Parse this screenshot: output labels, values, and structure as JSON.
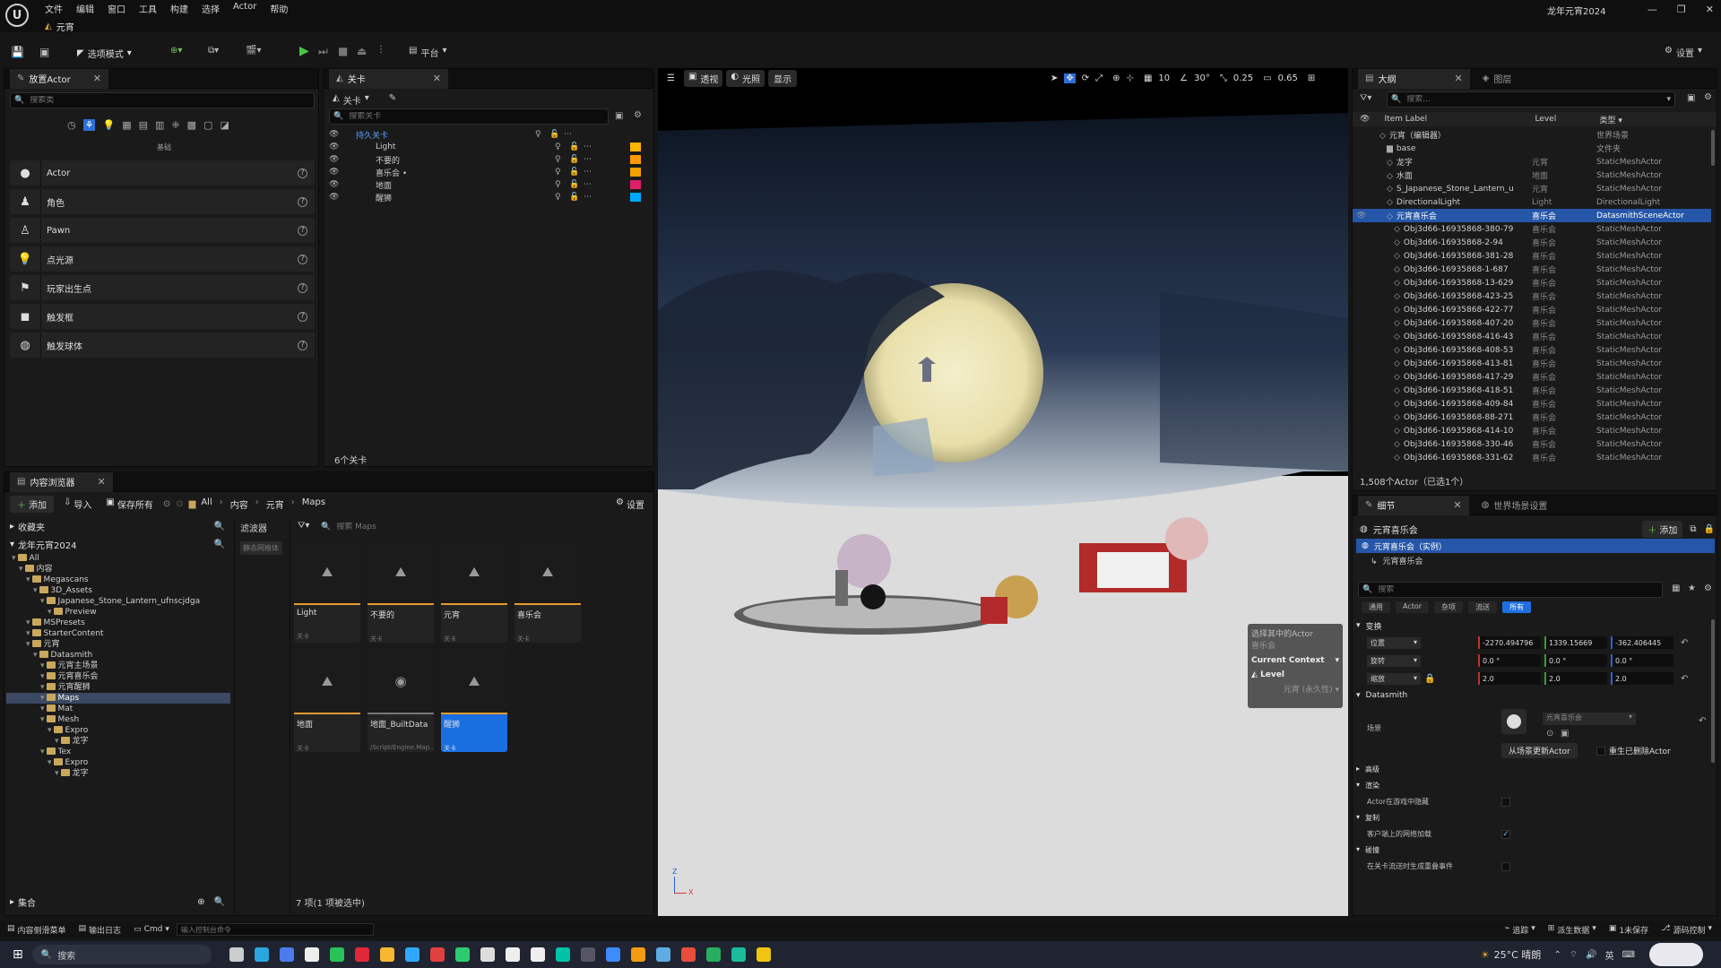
{
  "menu": [
    "文件",
    "编辑",
    "窗口",
    "工具",
    "构建",
    "选择",
    "Actor",
    "帮助"
  ],
  "project_name": "龙年元宵2024",
  "level_tab": "元宵",
  "toolbar": {
    "mode": "选项模式",
    "platform": "平台",
    "settings": "设置"
  },
  "place_actors": {
    "tab": "放置Actor",
    "search_placeholder": "搜索类",
    "category_label": "基础",
    "items": [
      "Actor",
      "角色",
      "Pawn",
      "点光源",
      "玩家出生点",
      "触发框",
      "触发球体"
    ]
  },
  "levels": {
    "tab": "关卡",
    "dropdown": "关卡",
    "search_placeholder": "搜索关卡",
    "rows": [
      {
        "name": "持久关卡",
        "color": "",
        "active": true
      },
      {
        "name": "Light",
        "color": "#ffb400"
      },
      {
        "name": "不要的",
        "color": "#ff9a00"
      },
      {
        "name": "喜乐会 •",
        "color": "#f0a000"
      },
      {
        "name": "地面",
        "color": "#e01f6b"
      },
      {
        "name": "醒狮",
        "color": "#00a8ff"
      }
    ],
    "count": "6个关卡"
  },
  "viewport": {
    "perspective": "透视",
    "lit": "光照",
    "show": "显示",
    "grid": "10",
    "angle": "30°",
    "scale": "0.25",
    "camera_speed": "0.65",
    "context": {
      "line1": "选择其中的Actor",
      "line2": "喜乐会",
      "current_context": "Current Context",
      "level": "Level",
      "value": "元宵 (永久性)"
    },
    "axis": {
      "z": "Z",
      "x": "X"
    }
  },
  "content_browser": {
    "tab": "内容浏览器",
    "add": "添加",
    "import": "导入",
    "save_all": "保存所有",
    "breadcrumb": [
      "All",
      "内容",
      "元宵",
      "Maps"
    ],
    "settings": "设置",
    "favorites": "收藏夹",
    "project_root": "龙年元宵2024",
    "filters": "滤波器",
    "filter_chip": "静态网格体",
    "search_placeholder": "搜索 Maps",
    "tree": [
      {
        "label": "All",
        "indent": 0
      },
      {
        "label": "内容",
        "indent": 1
      },
      {
        "label": "Megascans",
        "indent": 2
      },
      {
        "label": "3D_Assets",
        "indent": 3
      },
      {
        "label": "Japanese_Stone_Lantern_ufnscjdga",
        "indent": 4
      },
      {
        "label": "Preview",
        "indent": 5
      },
      {
        "label": "MSPresets",
        "indent": 2
      },
      {
        "label": "StarterContent",
        "indent": 2
      },
      {
        "label": "元宵",
        "indent": 2
      },
      {
        "label": "Datasmith",
        "indent": 3
      },
      {
        "label": "元宵主场景",
        "indent": 4
      },
      {
        "label": "元宵喜乐会",
        "indent": 4
      },
      {
        "label": "元宵醒狮",
        "indent": 4
      },
      {
        "label": "Maps",
        "indent": 4,
        "selected": true
      },
      {
        "label": "Mat",
        "indent": 4
      },
      {
        "label": "Mesh",
        "indent": 4
      },
      {
        "label": "Expro",
        "indent": 5
      },
      {
        "label": "龙字",
        "indent": 6
      },
      {
        "label": "Tex",
        "indent": 4
      },
      {
        "label": "Expro",
        "indent": 5
      },
      {
        "label": "龙字",
        "indent": 6
      }
    ],
    "assets": [
      {
        "name": "Light",
        "type": "关卡",
        "kind": "map"
      },
      {
        "name": "不要的",
        "type": "关卡",
        "kind": "map"
      },
      {
        "name": "元宵",
        "type": "关卡",
        "kind": "map"
      },
      {
        "name": "喜乐会",
        "type": "关卡",
        "kind": "map"
      },
      {
        "name": "地面",
        "type": "关卡",
        "kind": "map"
      },
      {
        "name": "地面_BuiltData",
        "type": "/Script/Engine.Map...",
        "kind": "builtdata"
      },
      {
        "name": "醒狮",
        "type": "关卡",
        "kind": "map",
        "selected": true
      }
    ],
    "status": "7 项(1 项被选中)",
    "collections": "集合"
  },
  "outliner": {
    "tab": "大纲",
    "tab2": "图层",
    "search_placeholder": "搜索...",
    "col_label": "Item Label",
    "col_level": "Level",
    "col_type": "类型",
    "rows": [
      {
        "label": "元宵（编辑器）",
        "level": "",
        "type": "世界场景",
        "indent": 1
      },
      {
        "label": "base",
        "level": "",
        "type": "文件夹",
        "indent": 2
      },
      {
        "label": "龙字",
        "level": "元宵",
        "type": "StaticMeshActor",
        "indent": 2
      },
      {
        "label": "水面",
        "level": "地面",
        "type": "StaticMeshActor",
        "indent": 2
      },
      {
        "label": "S_Japanese_Stone_Lantern_u",
        "level": "元宵",
        "type": "StaticMeshActor",
        "indent": 2
      },
      {
        "label": "DirectionalLight",
        "level": "Light",
        "type": "DirectionalLight",
        "indent": 2
      },
      {
        "label": "元宵喜乐会",
        "level": "喜乐会",
        "type": "DatasmithSceneActor",
        "indent": 2,
        "selected": true
      },
      {
        "label": "Obj3d66-16935868-380-79",
        "level": "喜乐会",
        "type": "StaticMeshActor",
        "indent": 3
      },
      {
        "label": "Obj3d66-16935868-2-94",
        "level": "喜乐会",
        "type": "StaticMeshActor",
        "indent": 3
      },
      {
        "label": "Obj3d66-16935868-381-28",
        "level": "喜乐会",
        "type": "StaticMeshActor",
        "indent": 3
      },
      {
        "label": "Obj3d66-16935868-1-687",
        "level": "喜乐会",
        "type": "StaticMeshActor",
        "indent": 3
      },
      {
        "label": "Obj3d66-16935868-13-629",
        "level": "喜乐会",
        "type": "StaticMeshActor",
        "indent": 3
      },
      {
        "label": "Obj3d66-16935868-423-25",
        "level": "喜乐会",
        "type": "StaticMeshActor",
        "indent": 3
      },
      {
        "label": "Obj3d66-16935868-422-77",
        "level": "喜乐会",
        "type": "StaticMeshActor",
        "indent": 3
      },
      {
        "label": "Obj3d66-16935868-407-20",
        "level": "喜乐会",
        "type": "StaticMeshActor",
        "indent": 3
      },
      {
        "label": "Obj3d66-16935868-416-43",
        "level": "喜乐会",
        "type": "StaticMeshActor",
        "indent": 3
      },
      {
        "label": "Obj3d66-16935868-408-53",
        "level": "喜乐会",
        "type": "StaticMeshActor",
        "indent": 3
      },
      {
        "label": "Obj3d66-16935868-413-81",
        "level": "喜乐会",
        "type": "StaticMeshActor",
        "indent": 3
      },
      {
        "label": "Obj3d66-16935868-417-29",
        "level": "喜乐会",
        "type": "StaticMeshActor",
        "indent": 3
      },
      {
        "label": "Obj3d66-16935868-418-51",
        "level": "喜乐会",
        "type": "StaticMeshActor",
        "indent": 3
      },
      {
        "label": "Obj3d66-16935868-409-84",
        "level": "喜乐会",
        "type": "StaticMeshActor",
        "indent": 3
      },
      {
        "label": "Obj3d66-16935868-88-271",
        "level": "喜乐会",
        "type": "StaticMeshActor",
        "indent": 3
      },
      {
        "label": "Obj3d66-16935868-414-10",
        "level": "喜乐会",
        "type": "StaticMeshActor",
        "indent": 3
      },
      {
        "label": "Obj3d66-16935868-330-46",
        "level": "喜乐会",
        "type": "StaticMeshActor",
        "indent": 3
      },
      {
        "label": "Obj3d66-16935868-331-62",
        "level": "喜乐会",
        "type": "StaticMeshActor",
        "indent": 3
      }
    ],
    "status": "1,508个Actor（已选1个）"
  },
  "details": {
    "tab": "细节",
    "tab2": "世界场景设置",
    "actor_name": "元宵喜乐会",
    "add": "添加",
    "instance": "元宵喜乐会（实例）",
    "component": "元宵喜乐会",
    "search_placeholder": "搜索",
    "filters": [
      "通用",
      "Actor",
      "杂项",
      "流送",
      "所有"
    ],
    "transform": "变换",
    "location": {
      "label": "位置",
      "x": "-2270.494796",
      "y": "1339.15669",
      "z": "-362.406445"
    },
    "rotation": {
      "label": "旋转",
      "x": "0.0 °",
      "y": "0.0 °",
      "z": "0.0 °"
    },
    "scale": {
      "label": "缩放",
      "x": "2.0",
      "y": "2.0",
      "z": "2.0"
    },
    "datasmith": "Datasmith",
    "scene_label": "场景",
    "scene_value": "元宵喜乐会",
    "update_btn": "从场景更新Actor",
    "respawn": "重生已删除Actor",
    "advanced": "高级",
    "rendering": "渲染",
    "hidden_in_game": "Actor在游戏中隐藏",
    "replication": "复制",
    "net_load": "客户端上的网络加载",
    "collision": "碰撞",
    "overlap": "在关卡流送时生成重叠事件"
  },
  "bottom_bar": {
    "content_drawer": "内容侧滑菜单",
    "output_log": "输出日志",
    "cmd": "Cmd",
    "console_placeholder": "输入控制台命令",
    "trace": "追踪",
    "derived_data": "派生数据",
    "unsaved": "1未保存",
    "source_control": "源码控制"
  },
  "taskbar": {
    "search": "搜索",
    "weather": "25°C 晴朗",
    "ime": "英",
    "apps": [
      "task-view",
      "edge",
      "k",
      "chrome-like",
      "wechat",
      "youdao",
      "app-color",
      "ps",
      "app-red",
      "app-green",
      "app-white",
      "unreal",
      "unreal",
      "m",
      "app-dark",
      "app-blue",
      "app-orange",
      "app-blue2",
      "app-red2",
      "app-green2",
      "app-3",
      "explorer"
    ]
  }
}
